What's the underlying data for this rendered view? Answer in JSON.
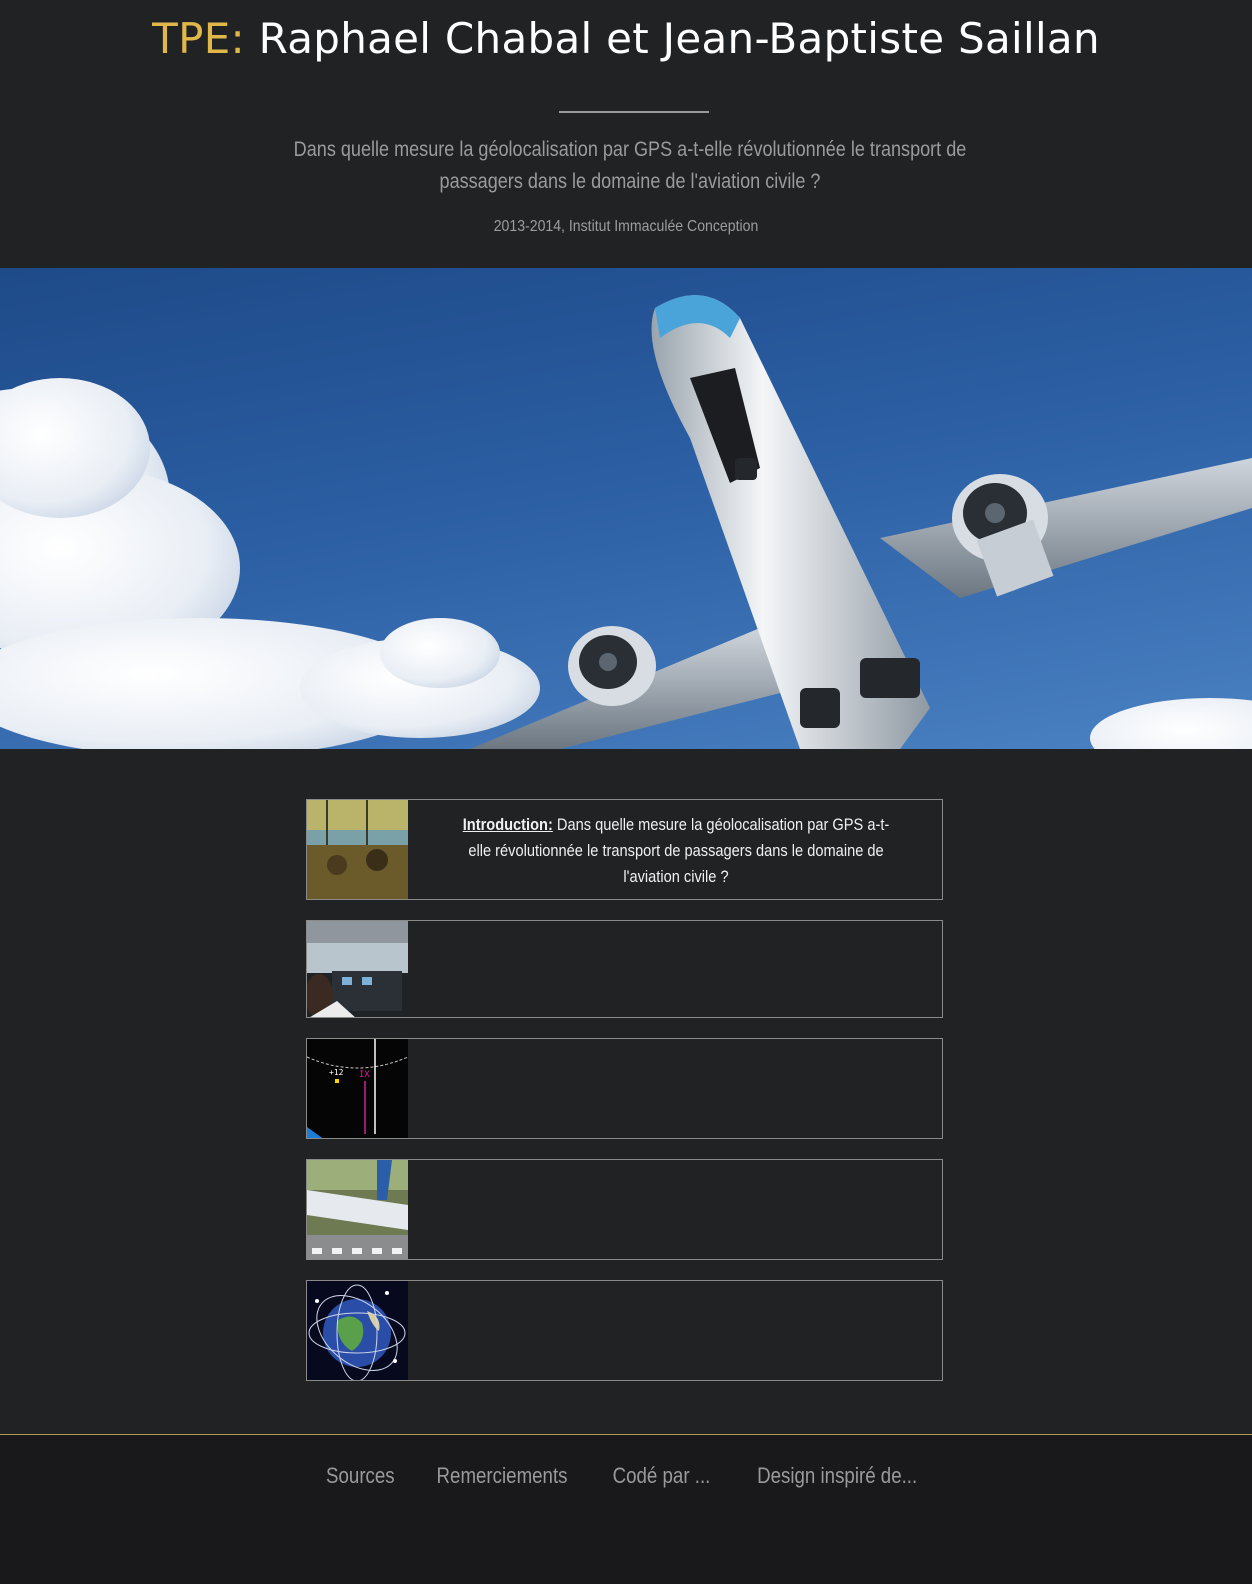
{
  "header": {
    "title_prefix": "TPE:",
    "title_main": " Raphael Chabal et Jean-Baptiste Saillan",
    "subtitle": "Dans quelle mesure la géolocalisation par GPS a-t-elle révolutionnée le transport de passagers dans le domaine de l'aviation civile ?",
    "meta": "2013-2014, Institut Immaculée Conception"
  },
  "colors": {
    "accent": "#e0b84a",
    "background": "#212224",
    "footer_bg": "#19191b",
    "footer_border": "#b39a4a"
  },
  "cards": [
    {
      "lead": "Introduction:",
      "text": " Dans quelle mesure la géolocalisation par GPS a-t-elle révolutionnée le transport de passagers dans le domaine de l'aviation civile ?",
      "thumb": "control-tower-photo"
    },
    {
      "lead": "",
      "text": "",
      "thumb": "cockpit-photo"
    },
    {
      "lead": "",
      "text": "",
      "thumb": "navigation-display-photo"
    },
    {
      "lead": "",
      "text": "",
      "thumb": "airplane-landing-photo"
    },
    {
      "lead": "",
      "text": "",
      "thumb": "gps-satellites-earth-photo"
    }
  ],
  "footer": {
    "links": [
      "Sources",
      "Remerciements",
      "Codé par ...",
      "Design inspiré de..."
    ]
  }
}
